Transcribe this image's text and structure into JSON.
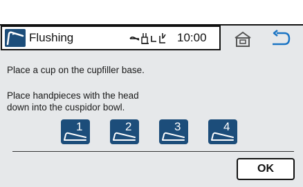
{
  "header": {
    "title": "Flushing",
    "time": "10:00",
    "app_icon": "handpiece-icon",
    "status_icons": [
      "handpiece-status-icon",
      "cupfiller-status-icon",
      "cuspidor-status-icon",
      "water-status-icon"
    ]
  },
  "nav": {
    "home_icon": "home-icon",
    "back_icon": "back-arrow-icon"
  },
  "instructions": {
    "line1": "Place a cup on the cupfiller base.",
    "line2": "Place handpieces with the head",
    "line3": "down into the cuspidor bowl."
  },
  "handpieces": [
    {
      "label": "1"
    },
    {
      "label": "2"
    },
    {
      "label": "3"
    },
    {
      "label": "4"
    }
  ],
  "footer": {
    "ok_label": "OK"
  },
  "colors": {
    "accent": "#1c4d7a",
    "panel": "#e6e8ea",
    "back_arrow": "#1a74c4"
  }
}
